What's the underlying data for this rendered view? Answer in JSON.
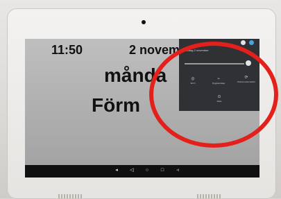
{
  "screen": {
    "time": "11:50",
    "date": "2 novem",
    "weekday": "månda",
    "daypart": "Förm"
  },
  "quick_settings": {
    "header": "måndag 2 november",
    "brightness": 0.9,
    "tiles": [
      {
        "icon": "wifi-icon",
        "glyph": "◎",
        "label": "Wi-Fi"
      },
      {
        "icon": "bluetooth-icon",
        "glyph": "⌁",
        "label": "Flygplansläge"
      },
      {
        "icon": "rotate-icon",
        "glyph": "⟳",
        "label": "Rotera automatiskt"
      },
      {
        "icon": "location-icon",
        "glyph": "⊙",
        "label": "Plats"
      }
    ]
  },
  "nav": {
    "buttons": [
      {
        "icon": "volume-down-icon",
        "glyph": "◂"
      },
      {
        "icon": "back-icon",
        "glyph": "◁"
      },
      {
        "icon": "home-icon",
        "glyph": "○"
      },
      {
        "icon": "recents-icon",
        "glyph": "□"
      },
      {
        "icon": "volume-up-icon",
        "glyph": "◃"
      }
    ]
  },
  "colors": {
    "highlight": "#e3201b",
    "panel": "#2a2c30"
  }
}
